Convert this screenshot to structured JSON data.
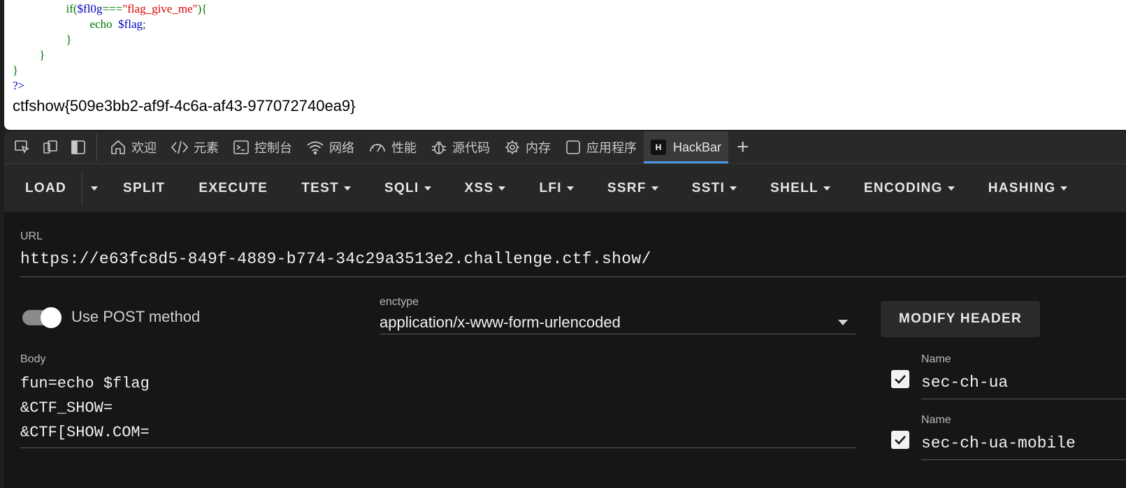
{
  "source": {
    "lines": [
      {
        "indent": "                  ",
        "parts": [
          [
            "kw",
            "if("
          ],
          [
            "var",
            "$fl0g"
          ],
          [
            "kw",
            "==="
          ],
          [
            "str",
            "\"flag_give_me\""
          ],
          [
            "kw",
            "){"
          ]
        ]
      },
      {
        "indent": "                          ",
        "parts": [
          [
            "kw",
            "echo  "
          ],
          [
            "var",
            "$flag"
          ],
          [
            "kw",
            ";"
          ]
        ]
      },
      {
        "indent": "                  ",
        "parts": [
          [
            "kw",
            "}"
          ]
        ]
      },
      {
        "indent": "         ",
        "parts": [
          [
            "kw",
            "}"
          ]
        ]
      },
      {
        "indent": "",
        "parts": [
          [
            "kw",
            "}"
          ]
        ]
      },
      {
        "indent": "",
        "parts": [
          [
            "tag",
            "?>"
          ]
        ]
      }
    ],
    "flag": "ctfshow{509e3bb2-af9f-4c6a-af43-977072740ea9}"
  },
  "devtools": {
    "tabs": [
      {
        "label": "欢迎",
        "icon": "home-icon"
      },
      {
        "label": "元素",
        "icon": "code-icon"
      },
      {
        "label": "控制台",
        "icon": "console-icon"
      },
      {
        "label": "网络",
        "icon": "wifi-icon"
      },
      {
        "label": "性能",
        "icon": "gauge-icon"
      },
      {
        "label": "源代码",
        "icon": "bug-icon"
      },
      {
        "label": "内存",
        "icon": "chip-icon"
      },
      {
        "label": "应用程序",
        "icon": "app-icon"
      },
      {
        "label": "HackBar",
        "icon": "hackbar-logo"
      }
    ],
    "active_tab": "HackBar",
    "hackbar_logo_letter": "H"
  },
  "hackbar": {
    "toolbar": {
      "load": "LOAD",
      "split": "SPLIT",
      "execute": "EXECUTE",
      "test": "TEST",
      "sqli": "SQLI",
      "xss": "XSS",
      "lfi": "LFI",
      "ssrf": "SSRF",
      "ssti": "SSTI",
      "shell": "SHELL",
      "encoding": "ENCODING",
      "hashing": "HASHING"
    },
    "url_label": "URL",
    "url": "https://e63fc8d5-849f-4889-b774-34c29a3513e2.challenge.ctf.show/",
    "post_label": "Use POST method",
    "post_enabled": true,
    "enctype_label": "enctype",
    "enctype": "application/x-www-form-urlencoded",
    "modify_header": "MODIFY HEADER",
    "body_label": "Body",
    "body": "fun=echo $flag\n&CTF_SHOW=\n&CTF[SHOW.COM=",
    "headers": [
      {
        "label": "Name",
        "name": "sec-ch-ua",
        "checked": true
      },
      {
        "label": "Name",
        "name": "sec-ch-ua-mobile",
        "checked": true
      }
    ]
  },
  "colors": {
    "accent": "#4a9be5",
    "background": "#161616",
    "toolbar": "#272727"
  }
}
